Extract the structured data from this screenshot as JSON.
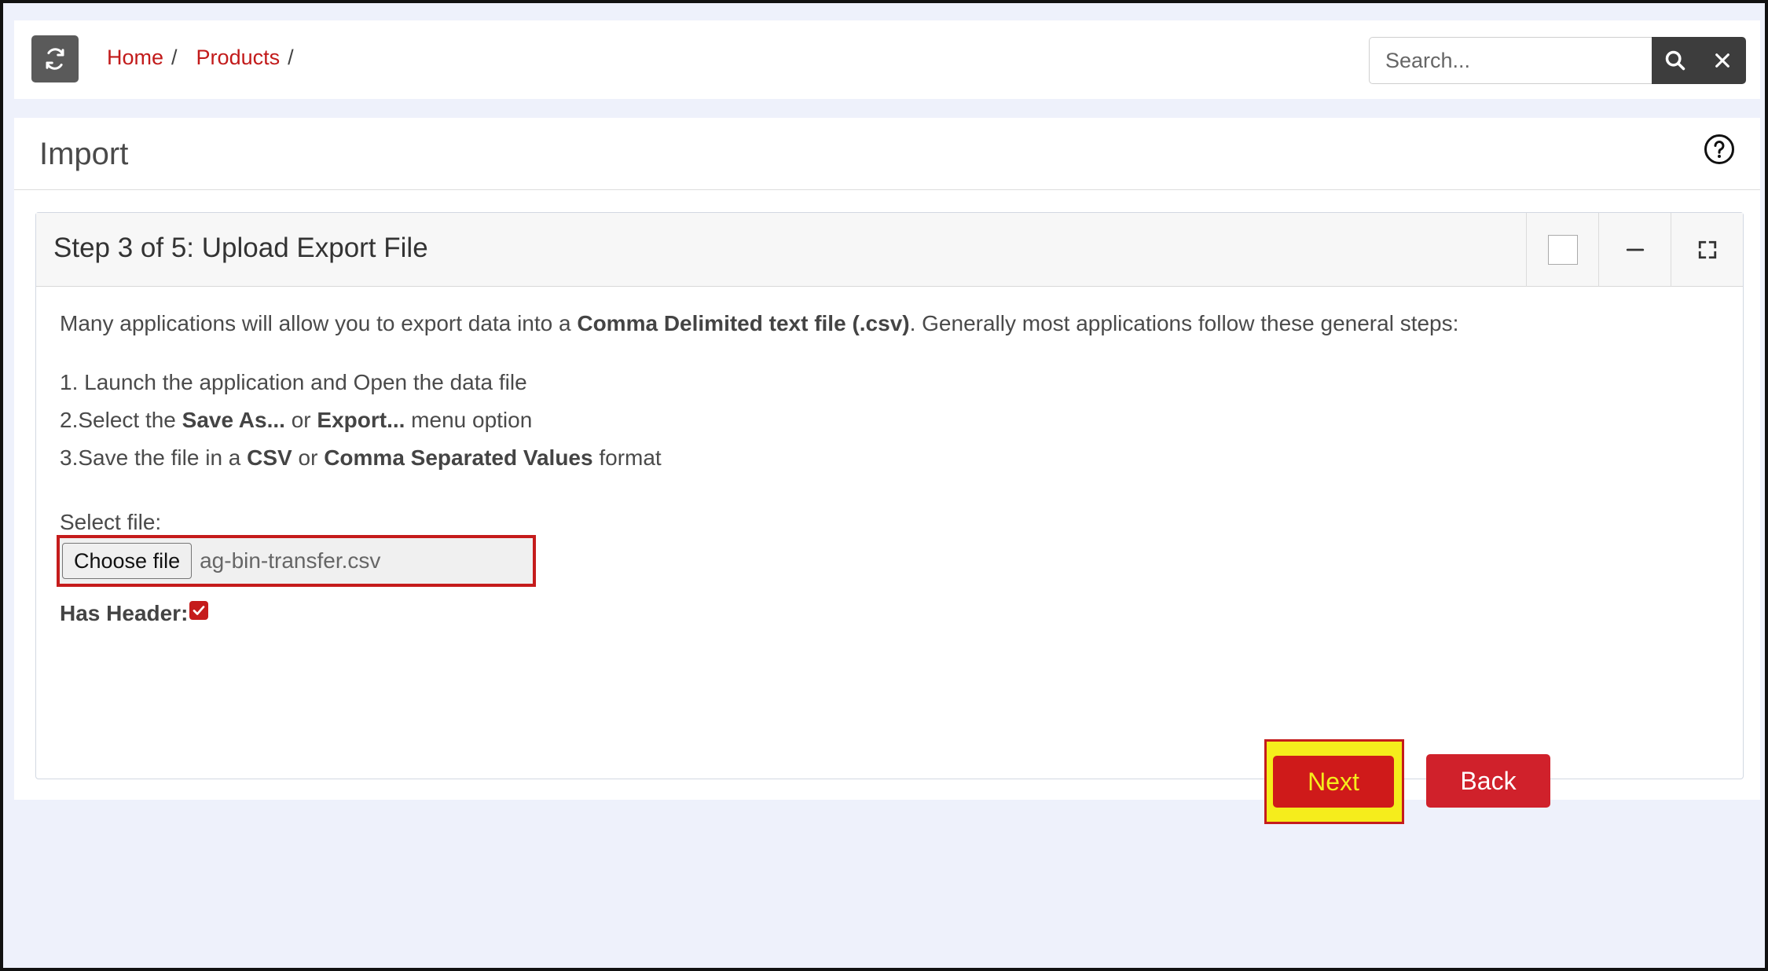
{
  "topbar": {
    "refresh_icon": "refresh-icon",
    "breadcrumb": [
      {
        "label": "Home"
      },
      {
        "label": "Products"
      }
    ],
    "separator": "/",
    "search": {
      "placeholder": "Search...",
      "value": ""
    },
    "search_icon": "search-icon",
    "clear_icon": "close-icon"
  },
  "page": {
    "title": "Import",
    "help_icon": "help-circle-icon"
  },
  "panel": {
    "title": "Step 3 of 5: Upload Export File",
    "tools": [
      "checkbox",
      "minimize-icon",
      "fullscreen-icon"
    ],
    "intro_prefix": "Many applications will allow you to export data into a ",
    "intro_bold": "Comma Delimited text file (.csv)",
    "intro_suffix": ". Generally most applications follow these general steps:",
    "step1": "1. Launch the application and Open the data file",
    "step2_a": "2.Select the ",
    "step2_b": "Save As...",
    "step2_c": " or ",
    "step2_d": "Export...",
    "step2_e": " menu option",
    "step3_a": "3.Save the file in a ",
    "step3_b": "CSV",
    "step3_c": " or ",
    "step3_d": "Comma Separated Values",
    "step3_e": " format",
    "select_label": "Select file:",
    "choose_button": "Choose file",
    "file_name": "ag-bin-transfer.csv",
    "has_header_label": "Has Header:",
    "has_header_checked": true,
    "next_label": "Next",
    "back_label": "Back"
  },
  "colors": {
    "accent": "#cf1a1a",
    "highlight": "#f5ed1c",
    "background": "#eef1fb"
  }
}
